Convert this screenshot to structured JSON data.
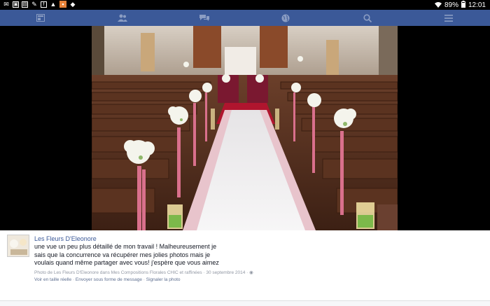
{
  "status_bar": {
    "battery": "89%",
    "time": "12:01",
    "notification_icons": [
      "mail-icon",
      "image-icon",
      "gallery-icon",
      "sms-icon",
      "facebook-icon",
      "warning-icon",
      "photos-icon",
      "dropbox-icon"
    ]
  },
  "nav": {
    "items": [
      "news-feed-icon",
      "friends-icon",
      "messages-icon",
      "notifications-globe-icon",
      "search-icon",
      "menu-icon"
    ]
  },
  "post": {
    "page_name": "Les Fleurs D'Eleonore",
    "text_lines": [
      "une vue un peu plus détaillé de mon travail ! Malheureusement je",
      "sais que la concurrence va récupérer mes jolies photos mais je",
      "voulais quand même partager avec vous! j'espère que vous aimez"
    ],
    "meta_line1": "Photo de Les Fleurs D'Eleonore dans Mes Compositions Florales CHIC et raffinées · 30 septembre 2014 · ",
    "actions": {
      "view_full": "Voir en taille réelle",
      "send_message": "Envoyer sous forme de message",
      "report": "Signaler la photo"
    }
  },
  "colors": {
    "nav_bg": "#3b5998",
    "status_bg": "#000000",
    "link": "#3b5998"
  }
}
